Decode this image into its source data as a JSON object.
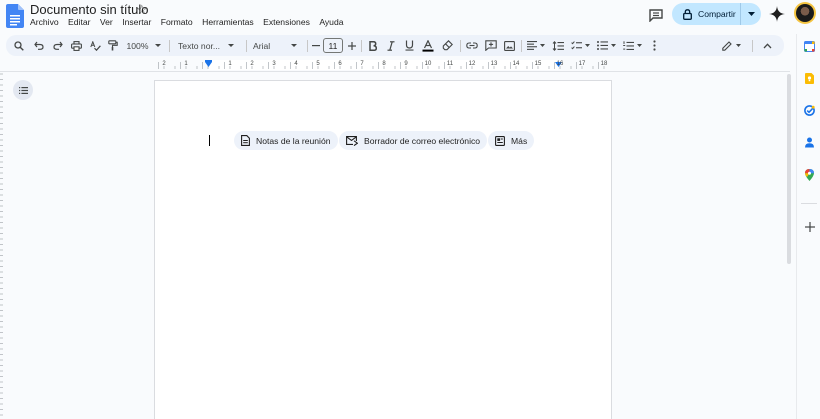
{
  "document": {
    "title": "Documento sin título"
  },
  "menu": [
    "Archivo",
    "Editar",
    "Ver",
    "Insertar",
    "Formato",
    "Herramientas",
    "Extensiones",
    "Ayuda"
  ],
  "share": {
    "label": "Compartir"
  },
  "toolbar": {
    "zoom": "100%",
    "style": "Texto nor...",
    "font": "Arial",
    "font_size": "11"
  },
  "ruler": {
    "labels": [
      "2",
      "1",
      "1",
      "2",
      "3",
      "4",
      "5",
      "6",
      "7",
      "8",
      "9",
      "10",
      "11",
      "12",
      "13",
      "14",
      "15",
      "16",
      "17",
      "18"
    ]
  },
  "chips": {
    "meeting_notes": "Notas de la reunión",
    "email_draft": "Borrador de correo electrónico",
    "more": "Más"
  },
  "colors": {
    "brand_blue": "#1a73e8",
    "share_bg": "#c2e7ff",
    "toolbar_bg": "#edf2fa"
  },
  "icons": {
    "docs_logo": "docs-logo-icon",
    "star": "star-icon",
    "comment": "comment-icon",
    "lock": "lock-icon",
    "gemini": "gemini-spark-icon"
  }
}
